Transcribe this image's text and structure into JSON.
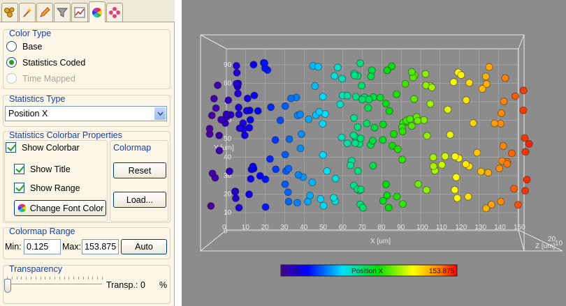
{
  "tabs": [
    {
      "name": "tab-spots",
      "icon": "spots-icon"
    },
    {
      "name": "tab-wizard",
      "icon": "wand-icon"
    },
    {
      "name": "tab-edit",
      "icon": "pencil-icon"
    },
    {
      "name": "tab-filter",
      "icon": "funnel-icon"
    },
    {
      "name": "tab-statistics",
      "icon": "chart-icon"
    },
    {
      "name": "tab-color",
      "icon": "color-wheel-icon"
    },
    {
      "name": "tab-settings",
      "icon": "gear-flower-icon"
    }
  ],
  "color_type": {
    "title": "Color Type",
    "options": [
      {
        "label": "Base",
        "state": "unchecked"
      },
      {
        "label": "Statistics Coded",
        "state": "checked"
      },
      {
        "label": "Time Mapped",
        "state": "disabled"
      }
    ]
  },
  "statistics_type": {
    "title": "Statistics Type",
    "selected": "Position X"
  },
  "colorbar_props": {
    "title": "Statistics Colorbar Properties",
    "show_colorbar": "Show Colorbar",
    "show_title": "Show Title",
    "show_range": "Show Range",
    "change_font_color": "Change Font Color",
    "colormap_title": "Colormap",
    "reset": "Reset",
    "load": "Load..."
  },
  "colormap_range": {
    "title": "Colormap Range",
    "min_label": "Min:",
    "min_value": "0.125",
    "max_label": "Max:",
    "max_value": "153.875",
    "auto": "Auto"
  },
  "transparency": {
    "title": "Transparency",
    "label": "Transp.:",
    "value": "0",
    "unit": "%",
    "level": 0
  },
  "viewer": {
    "background": "#8c8c8c",
    "x_axis_label": "X [um]",
    "y_axis_label": "Y [um]",
    "z_axis_label": "Z [um]",
    "x_ticks": [
      "0",
      "10",
      "20",
      "30",
      "40",
      "50",
      "60",
      "70",
      "80",
      "90",
      "100",
      "110",
      "120",
      "130",
      "140",
      "150"
    ],
    "y_ticks": [
      "90",
      "80",
      "70",
      "60",
      "50",
      "40",
      "30",
      "20",
      "10",
      "0"
    ],
    "z_ticks": [
      "20",
      "10"
    ],
    "colorbar": {
      "title": "Position X",
      "min": "0.125",
      "max": "153.875"
    }
  }
}
